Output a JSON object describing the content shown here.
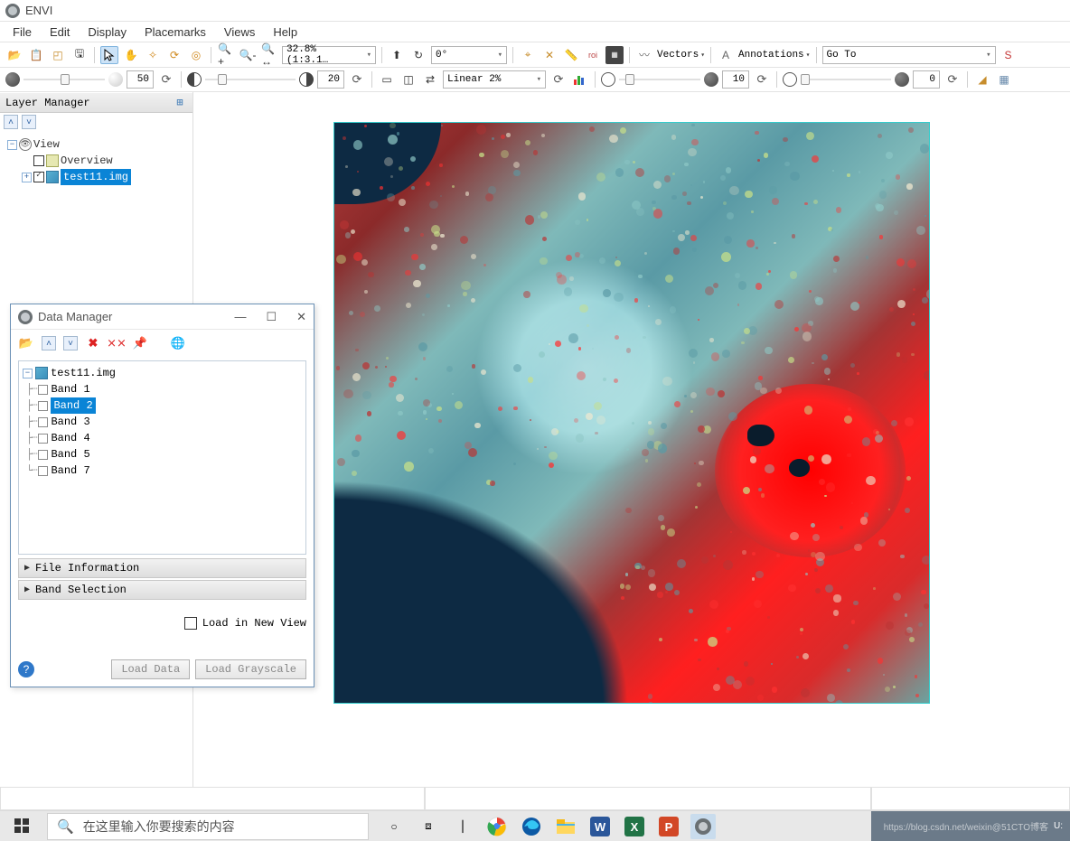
{
  "title": "ENVI",
  "menus": [
    "File",
    "Edit",
    "Display",
    "Placemarks",
    "Views",
    "Help"
  ],
  "toolbar1": {
    "zoom_display": "32.8% (1:3.1…",
    "rotation": "0°",
    "vectors_label": "Vectors",
    "annotations_label": "Annotations",
    "goto": "Go To"
  },
  "toolbar2": {
    "value_a": "50",
    "value_b": "20",
    "stretch": "Linear 2%",
    "value_c": "10",
    "value_d": "0"
  },
  "layer_panel": {
    "title": "Layer Manager",
    "root": "View",
    "overview": "Overview",
    "layer": "test11.img"
  },
  "data_manager": {
    "title": "Data Manager",
    "file": "test11.img",
    "bands": [
      "Band 1",
      "Band 2",
      "Band 3",
      "Band 4",
      "Band 5",
      "Band 7"
    ],
    "selected_band_index": 1,
    "sections": [
      "File Information",
      "Band Selection"
    ],
    "load_in_new_view_label": "Load in New View",
    "buttons": [
      "Load Data",
      "Load Grayscale"
    ]
  },
  "taskbar": {
    "search_placeholder": "在这里输入你要搜索的内容",
    "tray_time": "U:",
    "tray_url": "https://blog.csdn.net/weixin@51CTO博客"
  }
}
